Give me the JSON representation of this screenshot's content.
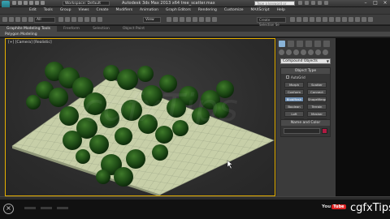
{
  "app": {
    "title": "Autodesk 3ds Max  2013 x64       tree_scatter.max",
    "workspace": "Workspace: Default",
    "search_placeholder": "Type a keyword or phrase"
  },
  "menu": [
    "Edit",
    "Tools",
    "Group",
    "Views",
    "Create",
    "Modifiers",
    "Animation",
    "Graph Editors",
    "Rendering",
    "Customize",
    "MAXScript",
    "Help"
  ],
  "toolbar": {
    "selection_filter": "All",
    "reference_coord": "View",
    "named_selection": "Create Selection Se"
  },
  "ribbon": {
    "tabs": [
      "Graphite Modeling Tools",
      "Freeform",
      "Selection",
      "Object Paint"
    ],
    "active_tab": 0,
    "subpanel": "Polygon Modeling"
  },
  "viewport": {
    "label": "[+] [Camera] [Realistic]",
    "watermark": "cgfxTips"
  },
  "command_panel": {
    "category_dropdown": "Compound Objects",
    "object_type_title": "Object Type",
    "autogrid_label": "AutoGrid",
    "buttons": [
      "Morph",
      "Scatter",
      "Conform",
      "Connect",
      "BlobMesh",
      "ShapeMerge",
      "Boolean",
      "Terrain",
      "Loft",
      "Mesher",
      "ProBoolean",
      "ProCutter"
    ],
    "active_button": 4,
    "name_color_title": "Name and Color",
    "swatch_color": "#b01a42"
  },
  "status": {
    "youtube_text": "You",
    "youtube_tube": "Tube",
    "channel": "cgfxTips"
  }
}
